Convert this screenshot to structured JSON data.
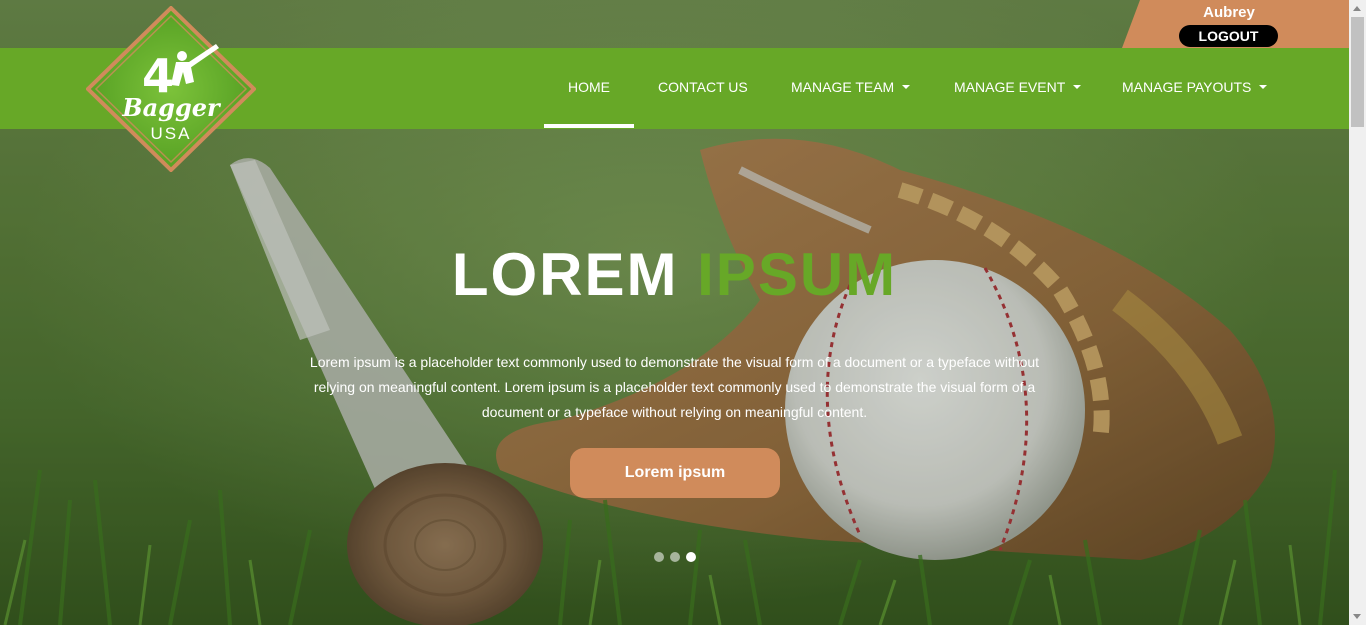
{
  "user": {
    "name": "Aubrey",
    "logout_label": "LOGOUT"
  },
  "brand": {
    "logo_number": "4",
    "logo_word": "Bagger",
    "logo_country": "USA"
  },
  "nav": {
    "home": "HOME",
    "contact": "CONTACT US",
    "manage_team": "MANAGE TEAM",
    "manage_event": "MANAGE EVENT",
    "manage_payouts": "MANAGE PAYOUTS",
    "active": "HOME"
  },
  "hero": {
    "title_white": "LOREM",
    "title_green": "IPSUM",
    "body": "Lorem ipsum is a placeholder text commonly used to demonstrate the visual form of a document or a typeface without relying on meaningful content. Lorem ipsum is a placeholder text commonly used to demonstrate the visual form of a document or a typeface without relying on meaningful content.",
    "cta_label": "Lorem ipsum",
    "slides_total": 3,
    "active_slide": 3
  },
  "colors": {
    "nav_green": "#67a827",
    "accent_orange": "#d08b5b",
    "logout_black": "#000000"
  }
}
